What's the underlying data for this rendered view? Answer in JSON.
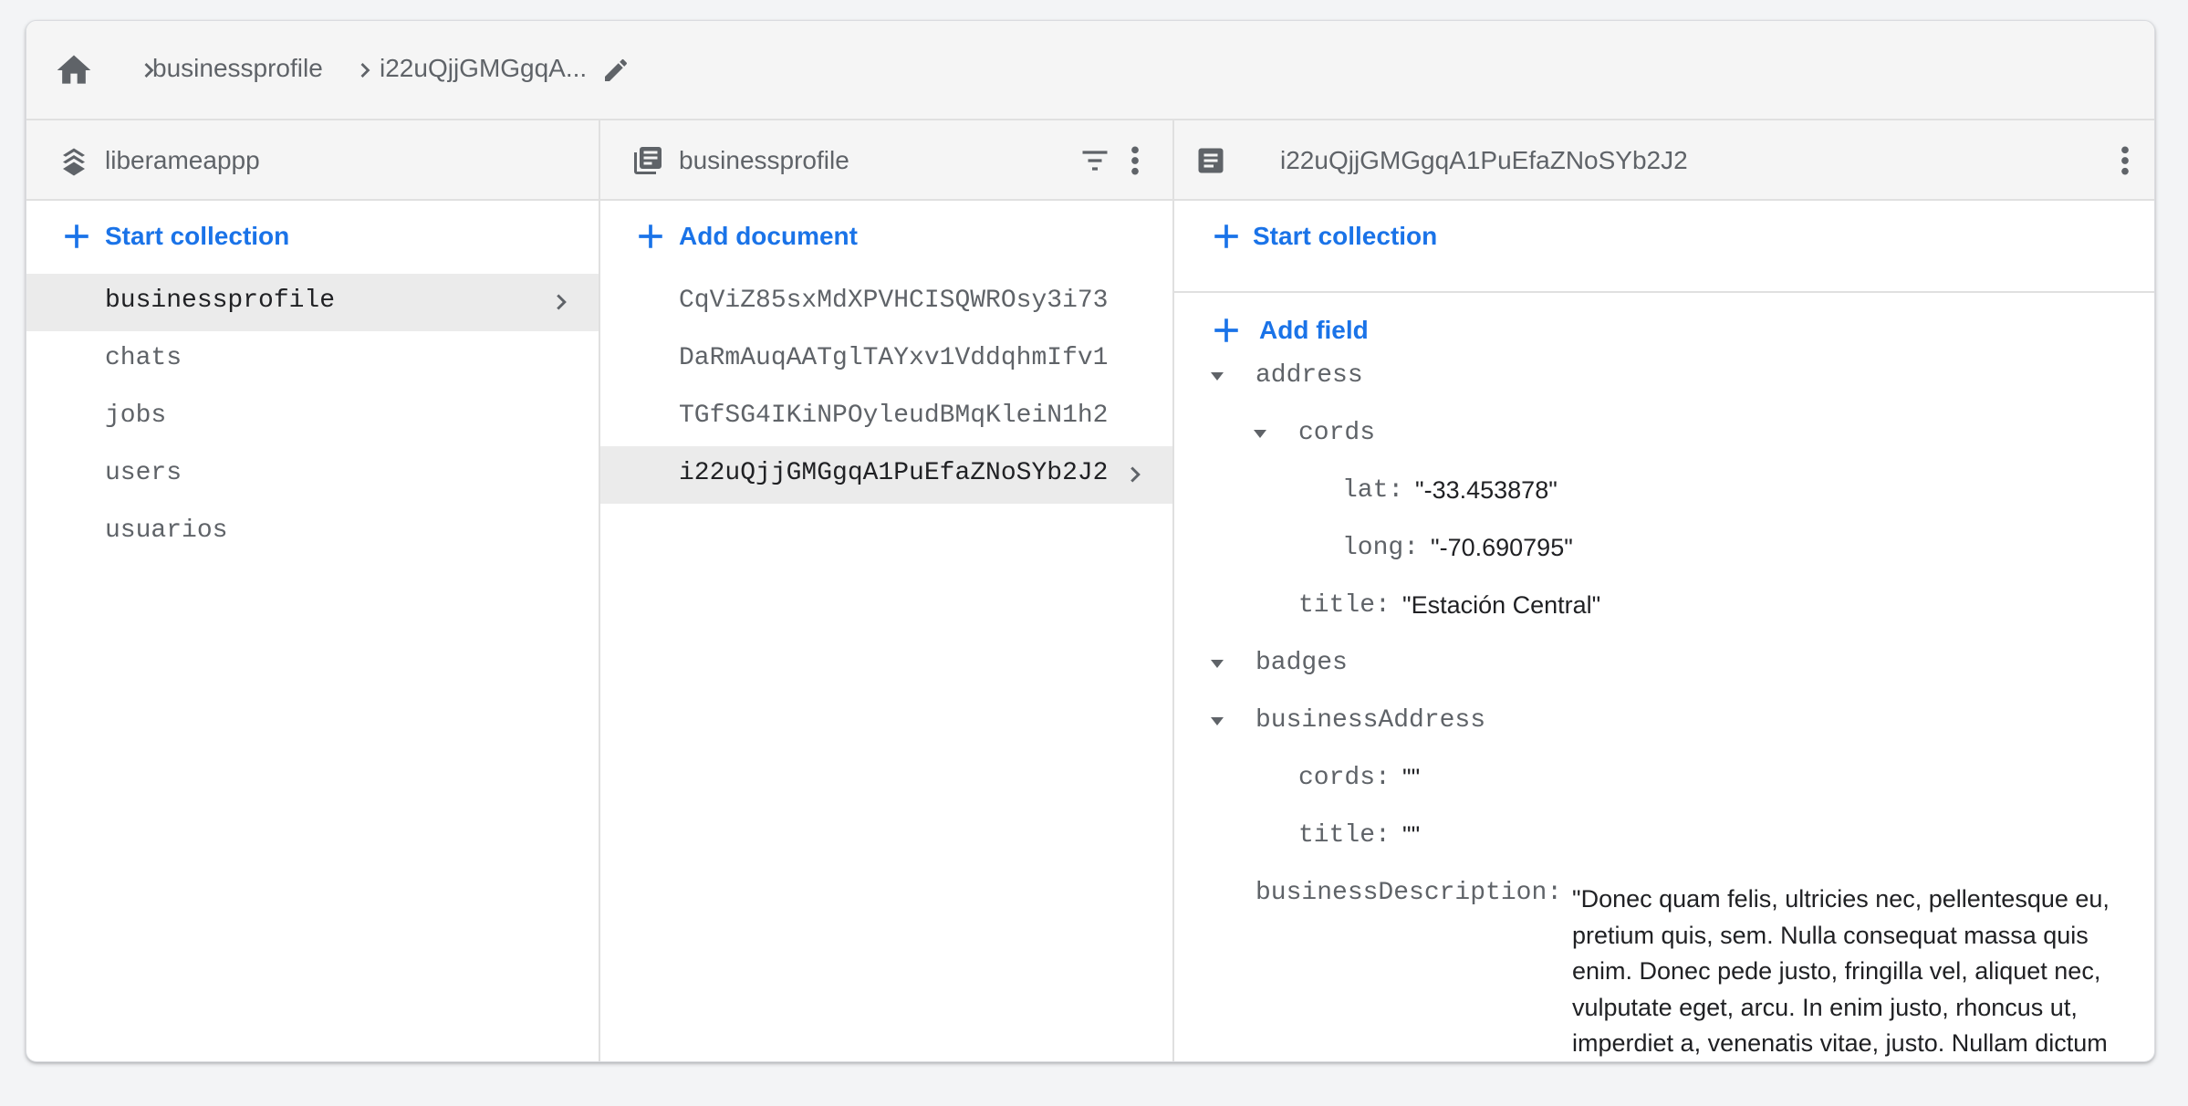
{
  "breadcrumb": {
    "home_icon": "home-icon",
    "items": [
      "businessprofile",
      "i22uQjjGMGgqA..."
    ],
    "edit_icon": "edit-pencil-icon"
  },
  "panels": {
    "root": {
      "title": "liberameappp",
      "icon": "firestore-stack-icon",
      "add_label": "Start collection",
      "items": [
        "businessprofile",
        "chats",
        "jobs",
        "users",
        "usuarios"
      ],
      "selected": "businessprofile"
    },
    "collection": {
      "title": "businessprofile",
      "icon": "collection-icon",
      "add_label": "Add document",
      "items": [
        "CqViZ85sxMdXPVHCISQWROsy3i73",
        "DaRmAuqAATglTAYxv1VddqhmIfv1",
        "TGfSG4IKiNPOyleudBMqKleiN1h2",
        "i22uQjjGMGgqA1PuEfaZNoSYb2J2"
      ],
      "selected": "i22uQjjGMGgqA1PuEfaZNoSYb2J2"
    },
    "document": {
      "title": "i22uQjjGMGgqA1PuEfaZNoSYb2J2",
      "icon": "document-icon",
      "start_collection_label": "Start collection",
      "add_field_label": "Add field",
      "fields": {
        "address_key": "address",
        "cords_key": "cords",
        "lat_key": "lat:",
        "lat_val": "\"-33.453878\"",
        "long_key": "long:",
        "long_val": "\"-70.690795\"",
        "title_key": "title:",
        "title_val": "\"Estación Central\"",
        "badges_key": "badges",
        "business_address_key": "businessAddress",
        "ba_cords_key": "cords:",
        "ba_cords_val": "\"\"",
        "ba_title_key": "title:",
        "ba_title_val": "\"\"",
        "business_description_key": "businessDescription:",
        "business_description_val": "\"Donec quam felis, ultricies nec, pellentesque eu, pretium quis, sem. Nulla consequat massa quis enim. Donec pede justo, fringilla vel, aliquet nec, vulputate eget, arcu. In enim justo, rhoncus ut, imperdiet a, venenatis vitae, justo. Nullam dictum felis eu pede mollis pretium. Integer tincidunt."
      }
    }
  },
  "colors": {
    "accent": "#1a73e8",
    "text_secondary": "#5f6368",
    "text_primary": "#202124",
    "selected_bg": "#ebebeb",
    "header_bg": "#f5f5f5"
  }
}
